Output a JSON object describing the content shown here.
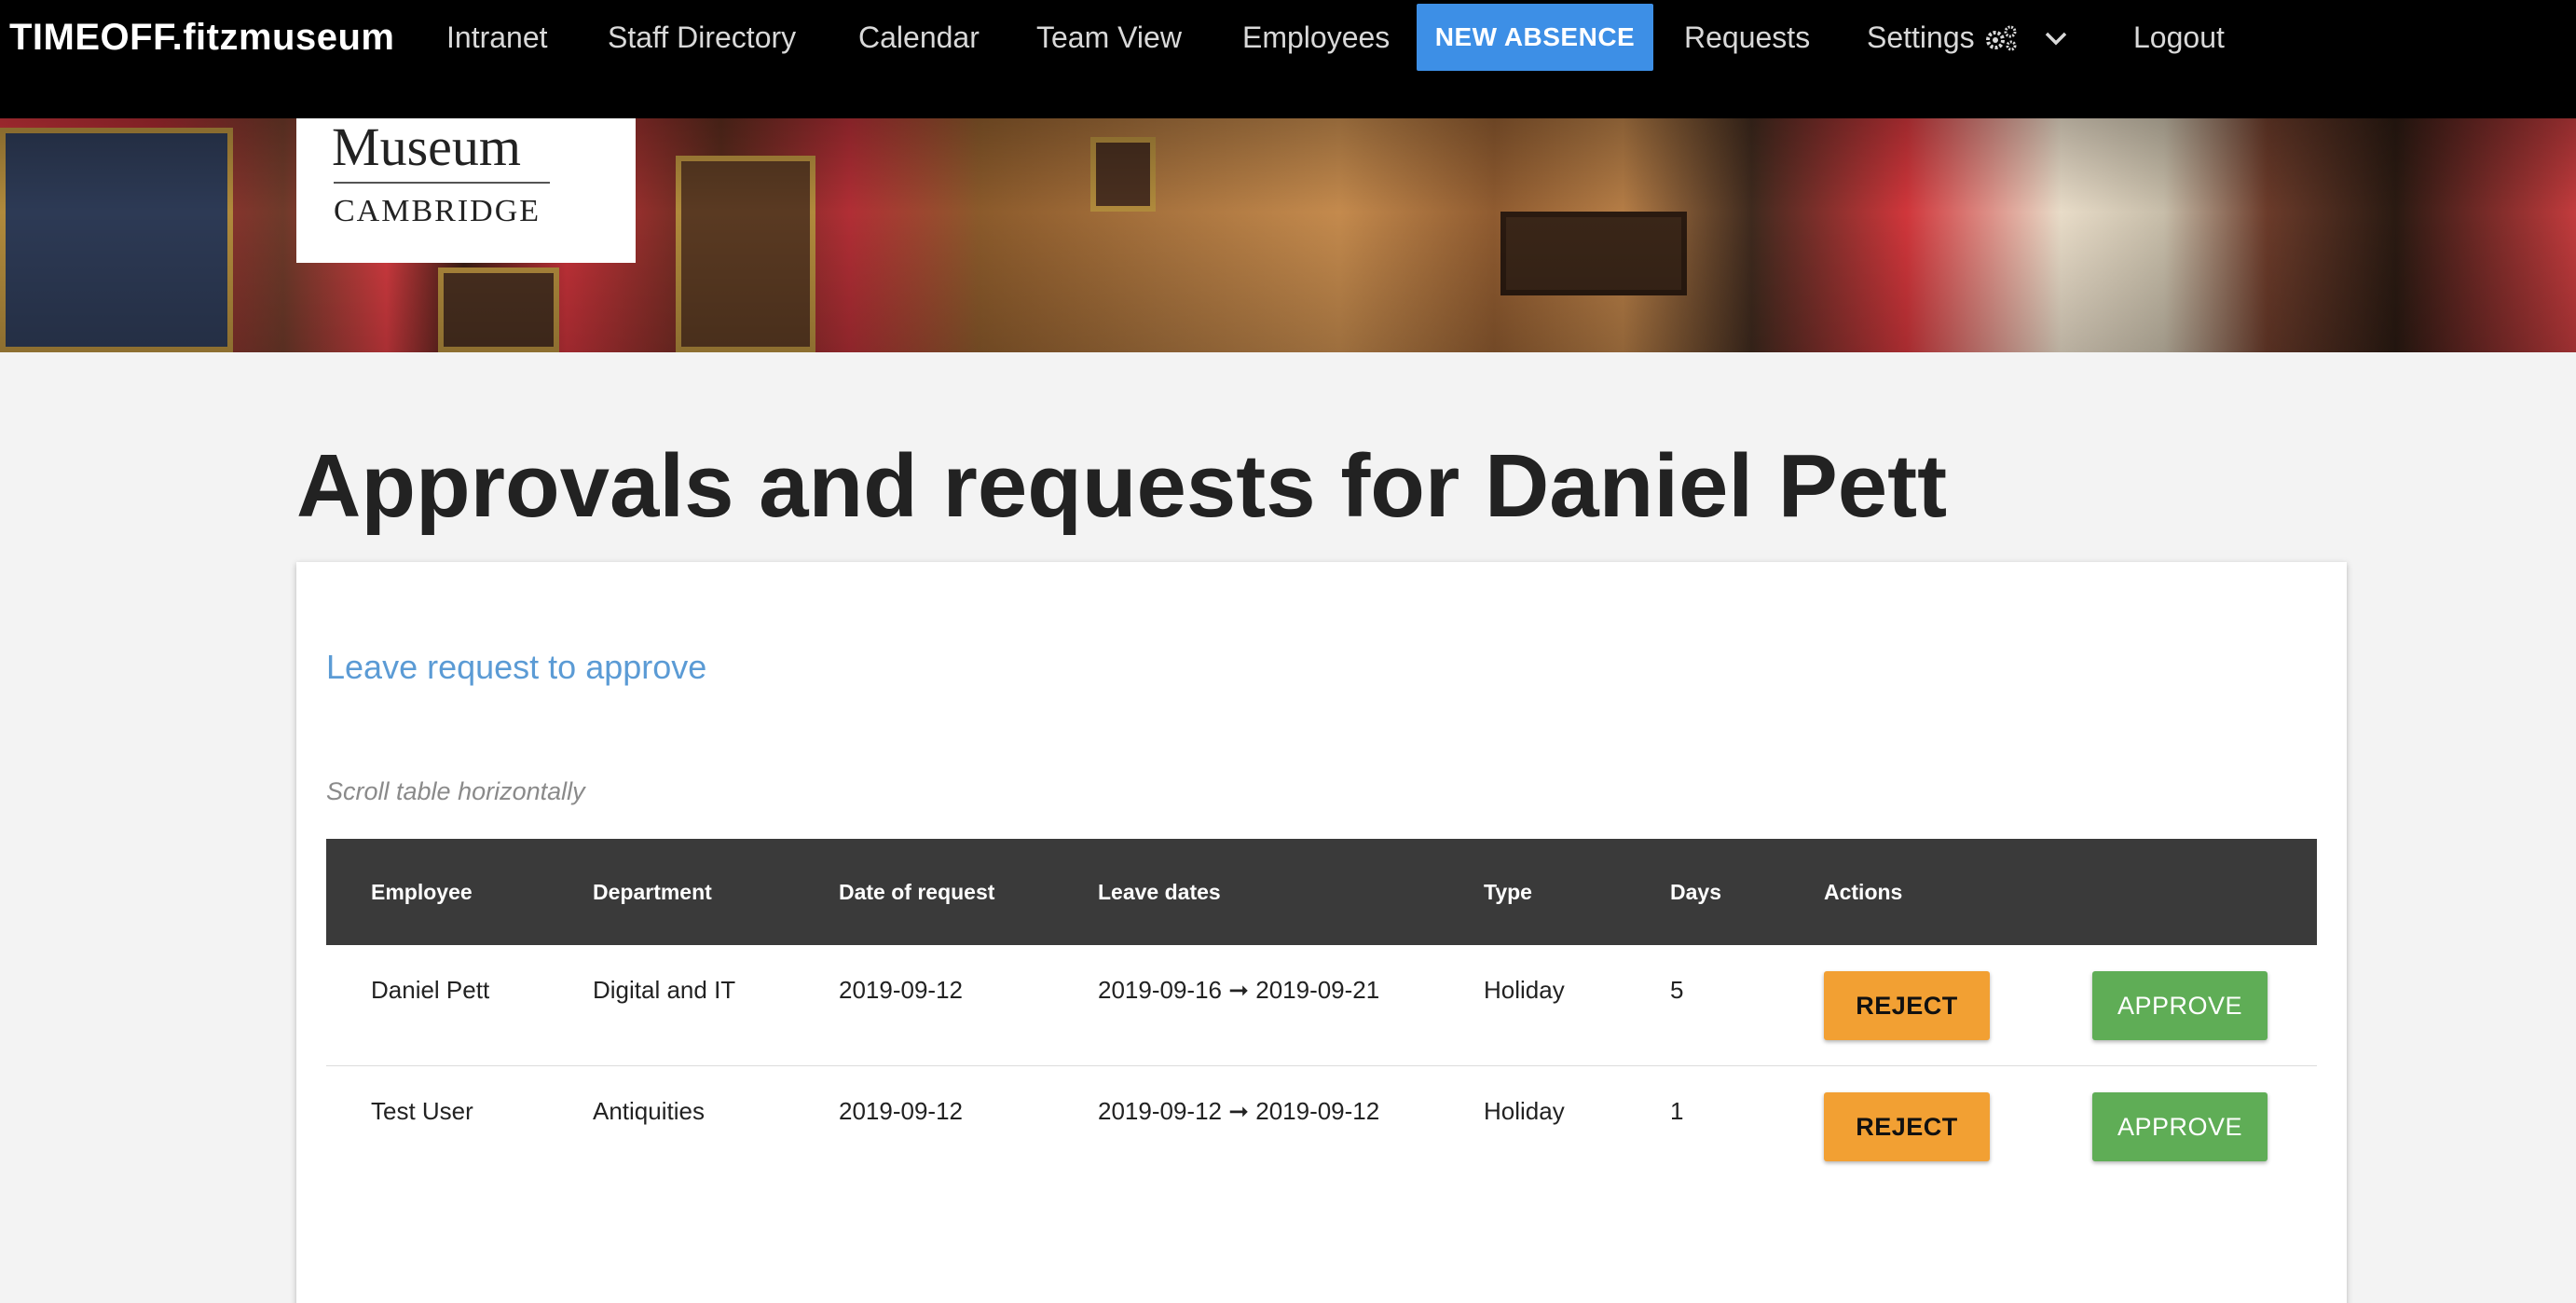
{
  "navbar": {
    "brand": "TIMEOFF.fitzmuseum",
    "items": [
      {
        "label": "Intranet"
      },
      {
        "label": "Staff Directory"
      },
      {
        "label": "Calendar"
      },
      {
        "label": "Team View"
      },
      {
        "label": "Employees"
      }
    ],
    "new_absence": "NEW ABSENCE",
    "requests": "Requests",
    "settings": "Settings",
    "logout": "Logout",
    "accent_color": "#3d8fe6"
  },
  "banner": {
    "logo_line1": "Museum",
    "logo_line2": "CAMBRIDGE"
  },
  "page": {
    "title": "Approvals and requests for Daniel Pett"
  },
  "card": {
    "section_title": "Leave request to approve",
    "hint": "Scroll table horizontally"
  },
  "table": {
    "headers": [
      "Employee",
      "Department",
      "Date of request",
      "Leave dates",
      "Type",
      "Days",
      "Actions"
    ],
    "rows": [
      {
        "employee": "Daniel Pett",
        "department": "Digital and IT",
        "date_of_request": "2019-09-12",
        "leave_dates": "2019-09-16 ➞ 2019-09-21",
        "type": "Holiday",
        "days": "5",
        "reject_label": "REJECT",
        "approve_label": "APPROVE"
      },
      {
        "employee": "Test User",
        "department": "Antiquities",
        "date_of_request": "2019-09-12",
        "leave_dates": "2019-09-12 ➞ 2019-09-12",
        "type": "Holiday",
        "days": "1",
        "reject_label": "REJECT",
        "approve_label": "APPROVE"
      }
    ],
    "reject_color": "#f2a033",
    "approve_color": "#5fad56"
  }
}
